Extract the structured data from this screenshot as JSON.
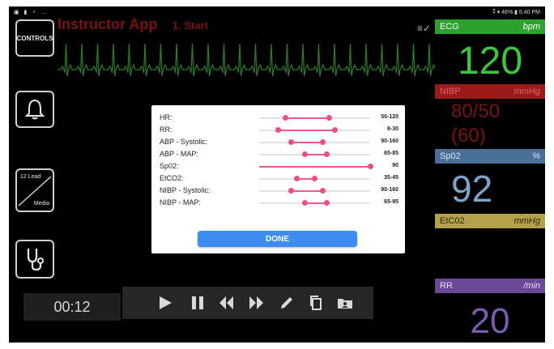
{
  "status_bar": {
    "left_icons": "▣ ▮ ♆ …",
    "right_text": "⁑ ▾ 46% ▮ 5:40 PM"
  },
  "header": {
    "app_title": "Instructor App",
    "step_label": "1. Start"
  },
  "left_rail": {
    "controls_label": "CONTROLS",
    "media_line1": "12 Lead",
    "media_line2": "Media"
  },
  "footer": {
    "timer": "00:12"
  },
  "vitals": [
    {
      "name": "ECG",
      "unit": "bpm",
      "values": [
        "120"
      ],
      "header_bg": "#2ea22e",
      "header_fg": "#ffffff",
      "value_color": "#3ec43e"
    },
    {
      "name": "NIBP",
      "unit": "mmHg",
      "values": [
        "80/50",
        "(60)"
      ],
      "header_bg": "#9b1a1a",
      "header_fg": "#d86a6a",
      "value_color": "#7a1414"
    },
    {
      "name": "Sp02",
      "unit": "%",
      "values": [
        "92"
      ],
      "header_bg": "#4a6f99",
      "header_fg": "#d9e3ef",
      "value_color": "#7fa2c7"
    },
    {
      "name": "EtC02",
      "unit": "mmHg",
      "values": [
        ""
      ],
      "header_bg": "#b3a24a",
      "header_fg": "#2a2a10",
      "value_color": "#d6c46a"
    },
    {
      "name": "RR",
      "unit": "/min",
      "values": [
        "20"
      ],
      "header_bg": "#6a4a97",
      "header_fg": "#e6dcf2",
      "value_color": "#7b5cb3"
    }
  ],
  "modal": {
    "rows": [
      {
        "label": "HR:",
        "range": "50-120",
        "low": 0.24,
        "high": 0.63
      },
      {
        "label": "RR:",
        "range": "8-30",
        "low": 0.17,
        "high": 0.68
      },
      {
        "label": "ABP - Systolic:",
        "range": "90-160",
        "low": 0.29,
        "high": 0.57
      },
      {
        "label": "ABP - MAP:",
        "range": "65-85",
        "low": 0.41,
        "high": 0.61
      },
      {
        "label": "Sp02:",
        "range": "90",
        "low": 0.0,
        "high": 1.0
      },
      {
        "label": "EtCO2:",
        "range": "35-45",
        "low": 0.34,
        "high": 0.5
      },
      {
        "label": "NIBP - Systolic:",
        "range": "90-160",
        "low": 0.29,
        "high": 0.57
      },
      {
        "label": "NIBP - MAP:",
        "range": "65-85",
        "low": 0.41,
        "high": 0.61
      }
    ],
    "done_label": "DONE"
  },
  "colors": {
    "slider_accent": "#ee4d82",
    "done_button": "#3d8df0",
    "ecg_trace": "#3ec43e"
  }
}
